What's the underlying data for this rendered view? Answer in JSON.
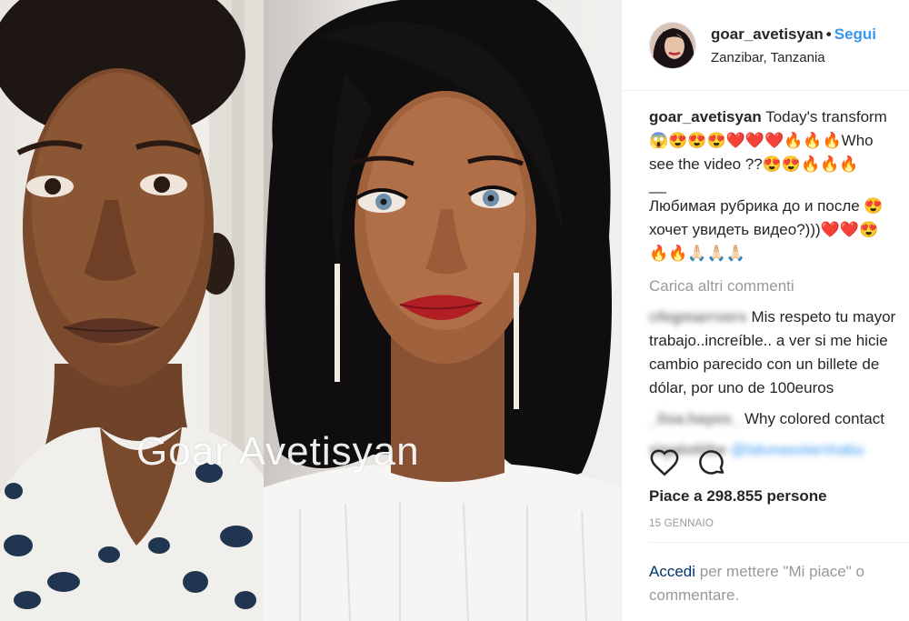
{
  "photo": {
    "watermark": "Goar Avetisyan",
    "before_alt": "before-photo",
    "after_alt": "after-photo"
  },
  "header": {
    "username": "goar_avetisyan",
    "dot": "•",
    "follow_label": "Segui",
    "location": "Zanzibar, Tanzania"
  },
  "caption": {
    "username": "goar_avetisyan",
    "line1": "Today's transform",
    "line2": "😱😍😍😍❤️❤️❤️🔥🔥🔥Who",
    "line3": "see the video ??😍😍🔥🔥🔥",
    "line4": "__",
    "line5": "Любимая рубрика до и после 😍",
    "line6": "хочет увидеть видео?)))❤️❤️😍",
    "line7": "🔥🔥🙏🏻🙏🏻🙏🏻"
  },
  "more_comments": "Carica altri commenti",
  "comments": [
    {
      "username": "cfegmarrvers",
      "text_first": "Mis respeto tu mayor",
      "text_rest": [
        "trabajo..increíble.. a ver si me hicie",
        "cambio parecido con un billete de",
        "dólar, por uno de 100euros"
      ]
    },
    {
      "username": "_lisa.hayes_",
      "text_first": "Why colored contact"
    },
    {
      "username": "sigalottibe",
      "text_link": "@lalunasolarnhabu"
    }
  ],
  "actions": {
    "like_icon": "heart-icon",
    "comment_icon": "comment-icon"
  },
  "likes": "Piace a 298.855 persone",
  "date": "15 GENNAIO",
  "login": {
    "link": "Accedi",
    "rest": " per mettere \"Mi piace\" o commentare."
  },
  "colors": {
    "link_blue": "#3897f0",
    "muted": "#999999",
    "text": "#262626",
    "login_link": "#003569"
  }
}
